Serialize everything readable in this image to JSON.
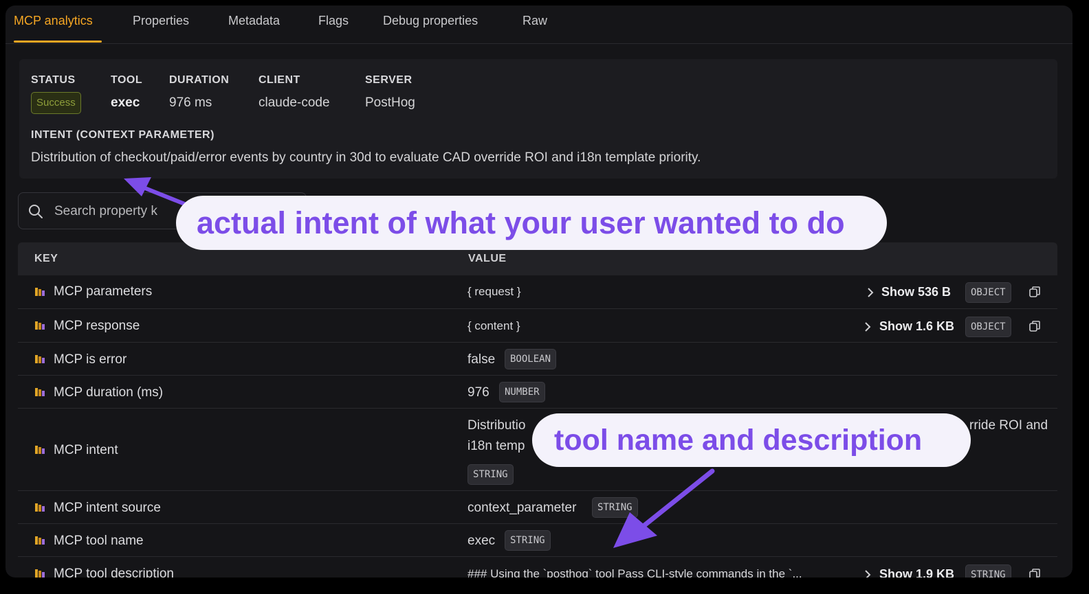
{
  "tabs": [
    "MCP analytics",
    "Properties",
    "Metadata",
    "Flags",
    "Debug properties",
    "Raw"
  ],
  "summary": {
    "status_label": "STATUS",
    "status_value": "Success",
    "tool_label": "TOOL",
    "tool_value": "exec",
    "duration_label": "DURATION",
    "duration_value": "976 ms",
    "client_label": "CLIENT",
    "client_value": "claude-code",
    "server_label": "SERVER",
    "server_value": "PostHog",
    "intent_label": "INTENT (CONTEXT PARAMETER)",
    "intent_text": "Distribution of checkout/paid/error events by country in 30d to evaluate CAD override ROI and i18n template priority."
  },
  "search": {
    "placeholder": "Search property k"
  },
  "table": {
    "key_header": "KEY",
    "value_header": "VALUE",
    "rows": [
      {
        "key": "MCP parameters",
        "value": "{ request }",
        "show": "Show 536 B",
        "type": "OBJECT"
      },
      {
        "key": "MCP response",
        "value": "{ content }",
        "show": "Show 1.6 KB",
        "type": "OBJECT"
      },
      {
        "key": "MCP is error",
        "value": "false",
        "type": "BOOLEAN"
      },
      {
        "key": "MCP duration (ms)",
        "value": "976",
        "type": "NUMBER"
      },
      {
        "key": "MCP intent",
        "value_line1": "Distributio",
        "value_line1_end": "rride ROI and",
        "value_line2": "i18n temp",
        "type": "STRING"
      },
      {
        "key": "MCP intent source",
        "value": "context_parameter",
        "type": "STRING"
      },
      {
        "key": "MCP tool name",
        "value": "exec",
        "type": "STRING"
      },
      {
        "key": "MCP tool description",
        "value": "### Using the `posthog` tool Pass CLI-style commands in the `...",
        "show": "Show 1.9 KB",
        "type": "STRING"
      }
    ]
  },
  "annotations": {
    "callout1": "actual intent of what your user wanted to do",
    "callout2": "tool name and description"
  },
  "colors": {
    "accent": "#f5a623",
    "callout_text": "#7c4de8",
    "callout_bg": "#f4f2fb",
    "success": "#8e9e3a"
  },
  "icons": [
    "search-icon",
    "property-icon",
    "chevron-right-icon",
    "copy-icon",
    "arrow-icon"
  ]
}
